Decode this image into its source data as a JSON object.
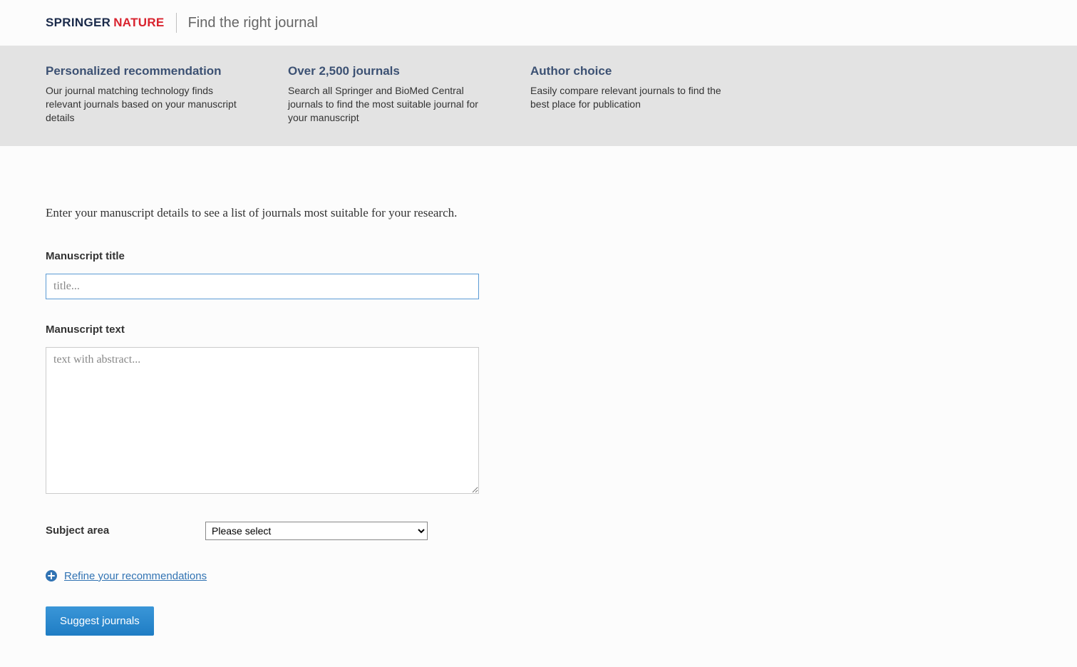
{
  "header": {
    "logo_part1": "Springer",
    "logo_part2": "Nature",
    "tagline": "Find the right journal"
  },
  "features": [
    {
      "title": "Personalized recommendation",
      "desc": "Our journal matching technology finds relevant journals based on your manuscript details"
    },
    {
      "title": "Over 2,500 journals",
      "desc": "Search all Springer and BioMed Central journals to find the most suitable journal for your manuscript"
    },
    {
      "title": "Author choice",
      "desc": "Easily compare relevant journals to find the best place for publication"
    }
  ],
  "main": {
    "intro": "Enter your manuscript details to see a list of journals most suitable for your research.",
    "title_label": "Manuscript title",
    "title_placeholder": "title...",
    "title_value": "",
    "text_label": "Manuscript text",
    "text_placeholder": "text with abstract...",
    "text_value": "",
    "subject_label": "Subject area",
    "subject_selected": "Please select",
    "refine_link": "Refine your recommendations",
    "suggest_button": "Suggest journals"
  }
}
